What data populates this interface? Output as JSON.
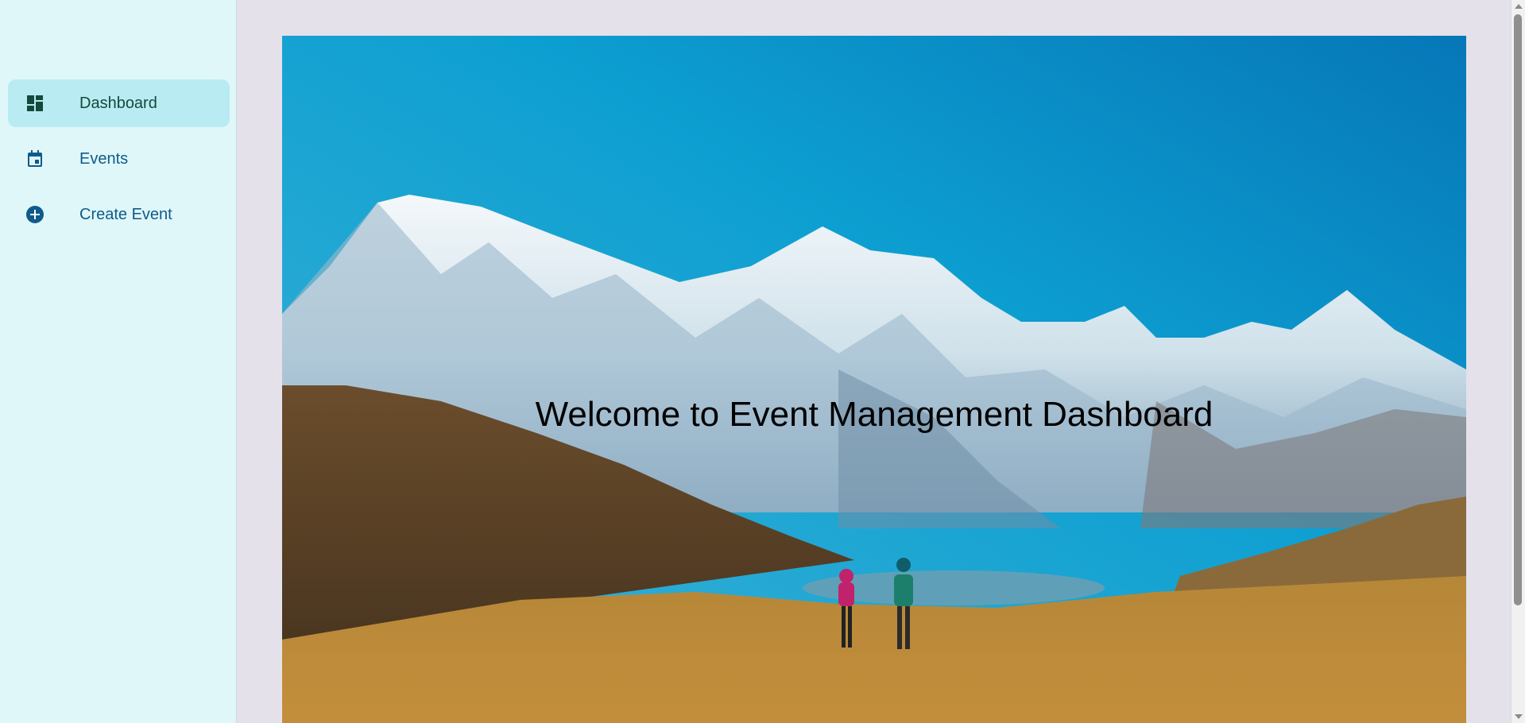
{
  "sidebar": {
    "items": [
      {
        "label": "Dashboard",
        "icon": "dashboard-icon",
        "active": true
      },
      {
        "label": "Events",
        "icon": "calendar-icon",
        "active": false
      },
      {
        "label": "Create Event",
        "icon": "add-circle-icon",
        "active": false
      }
    ]
  },
  "main": {
    "hero_title": "Welcome to Event Management Dashboard"
  },
  "colors": {
    "sidebar_bg": "#dff7f9",
    "active_item_bg": "#b8ebf2",
    "nav_text": "#0f5b8a",
    "page_bg": "#e4e1ea"
  }
}
